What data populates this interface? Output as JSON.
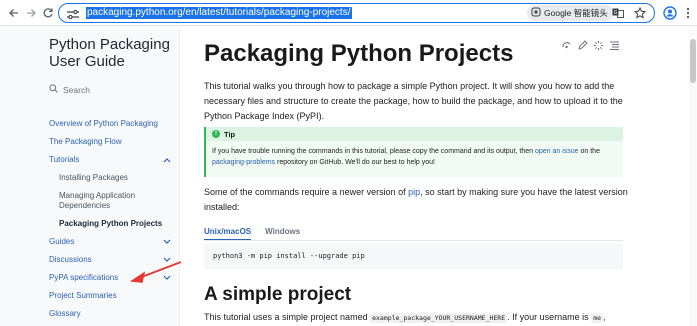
{
  "browser": {
    "url": "packaging.python.org/en/latest/tutorials/packaging-projects/",
    "lens_chip_label": "Google 智能镜头"
  },
  "sidebar": {
    "site_title": "Python Packaging User Guide",
    "search_label": "Search",
    "items": [
      {
        "label": "Overview of Python Packaging"
      },
      {
        "label": "The Packaging Flow"
      },
      {
        "label": "Tutorials"
      },
      {
        "label": "Installing Packages"
      },
      {
        "label": "Managing Application Dependencies"
      },
      {
        "label": "Packaging Python Projects"
      },
      {
        "label": "Guides"
      },
      {
        "label": "Discussions"
      },
      {
        "label": "PyPA specifications"
      },
      {
        "label": "Project Summaries"
      },
      {
        "label": "Glossary"
      }
    ]
  },
  "main": {
    "title": "Packaging Python Projects",
    "intro": "This tutorial walks you through how to package a simple Python project. It will show you how to add the necessary files and structure to create the package, how to build the package, and how to upload it to the Python Package Index (PyPI).",
    "tip": {
      "label": "Tip",
      "text_1": "If you have trouble running the commands in this tutorial, please copy the command and its output, then ",
      "link_1": "open an issue",
      "text_2": " on the ",
      "link_2": "packaging-problems",
      "text_3": " repository on GitHub. We'll do our best to help you!"
    },
    "pip_note": {
      "text_1": "Some of the commands require a newer version of ",
      "link": "pip",
      "text_2": ", so start by making sure you have the latest version installed:"
    },
    "tabs": [
      "Unix/macOS",
      "Windows"
    ],
    "code": "python3 -m pip install --upgrade pip",
    "section_title": "A simple project",
    "section_text_1": "This tutorial uses a simple project named ",
    "section_code_1": "example_package_YOUR_USERNAME_HERE",
    "section_text_2": ". If your username is ",
    "section_code_2": "me",
    "section_text_3": ","
  },
  "colors": {
    "accent": "#1a73e8",
    "link": "#2962b4",
    "tip_green": "#2fb855",
    "annotation_arrow": "#e53935"
  },
  "icons": [
    "back-icon",
    "forward-icon",
    "reload-icon",
    "site-info-icon",
    "lens-icon",
    "translate-icon",
    "bookmark-star-icon",
    "profile-icon",
    "menu-icon",
    "search-icon",
    "chevron-up-icon",
    "chevron-down-icon",
    "theme-icon",
    "edit-icon",
    "view-source-icon",
    "toc-icon"
  ]
}
